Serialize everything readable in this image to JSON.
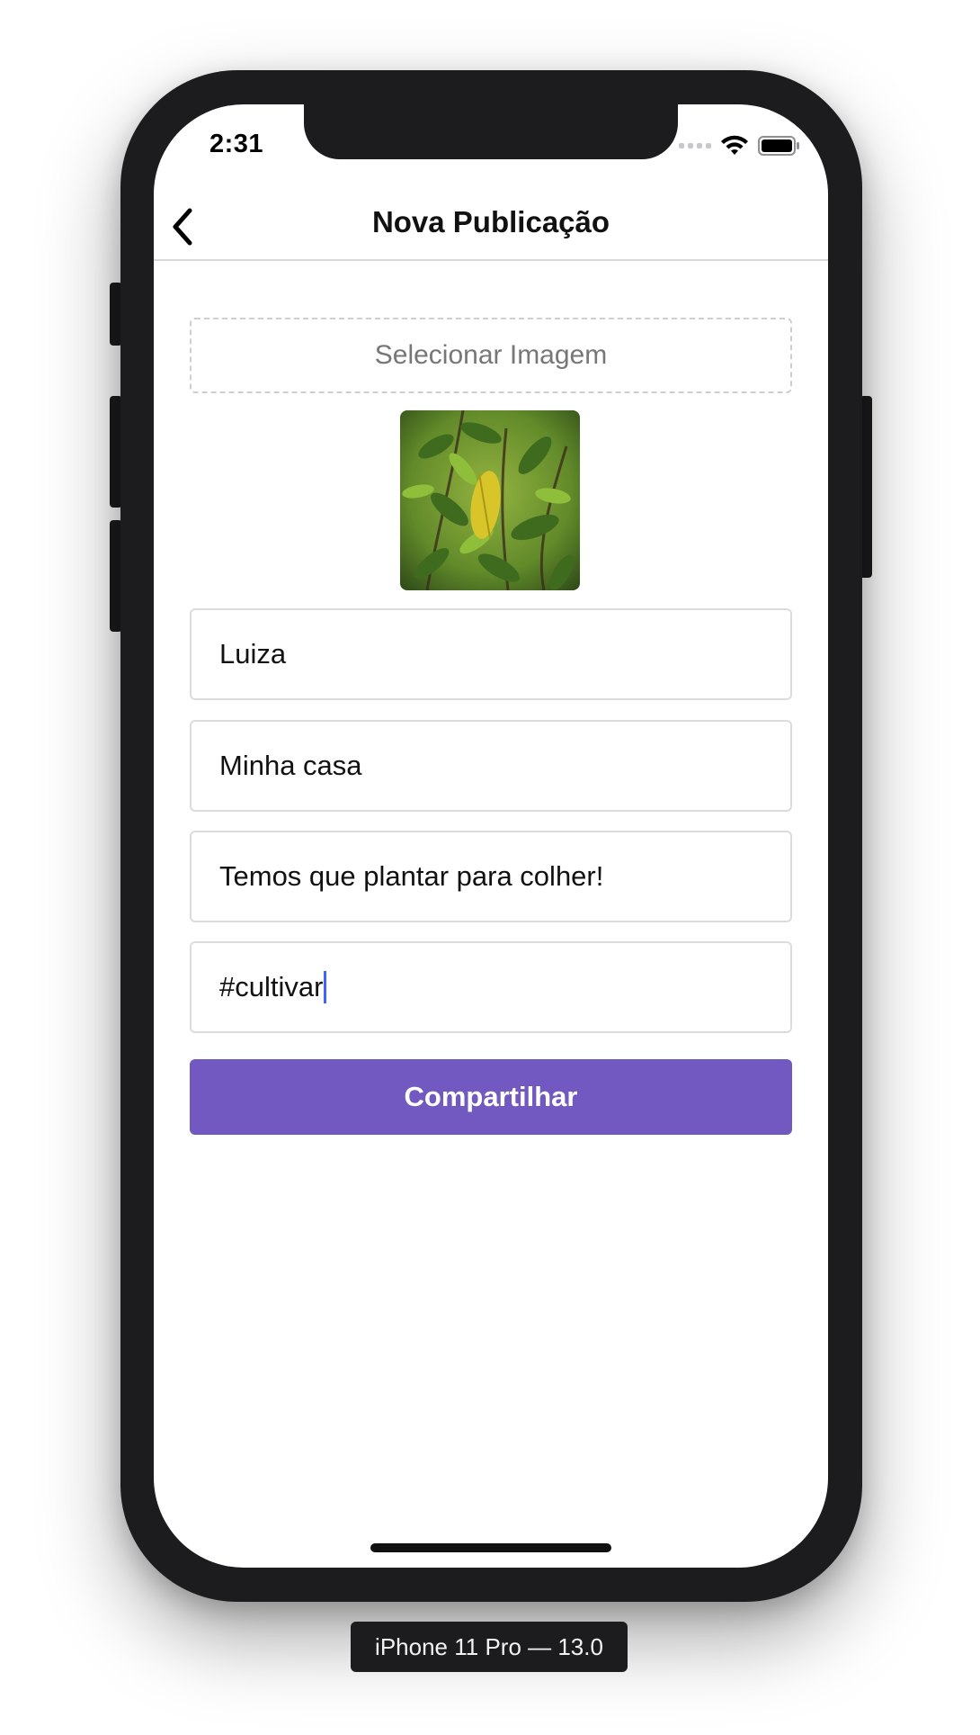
{
  "status_bar": {
    "time": "2:31"
  },
  "navbar": {
    "title": "Nova Publicação"
  },
  "form": {
    "select_image_label": "Selecionar Imagem",
    "fields": [
      {
        "value": "Luiza"
      },
      {
        "value": "Minha casa"
      },
      {
        "value": "Temos que plantar para colher!"
      },
      {
        "value": "#cultivar"
      }
    ],
    "submit_label": "Compartilhar"
  },
  "device_label": "iPhone 11 Pro — 13.0",
  "colors": {
    "accent": "#7159c1",
    "caret": "#3f63ff",
    "frame": "#1c1c1e"
  },
  "icons": {
    "back": "chevron-left-icon",
    "signal": "cellular-signal-icon",
    "wifi": "wifi-icon",
    "battery": "battery-icon"
  }
}
